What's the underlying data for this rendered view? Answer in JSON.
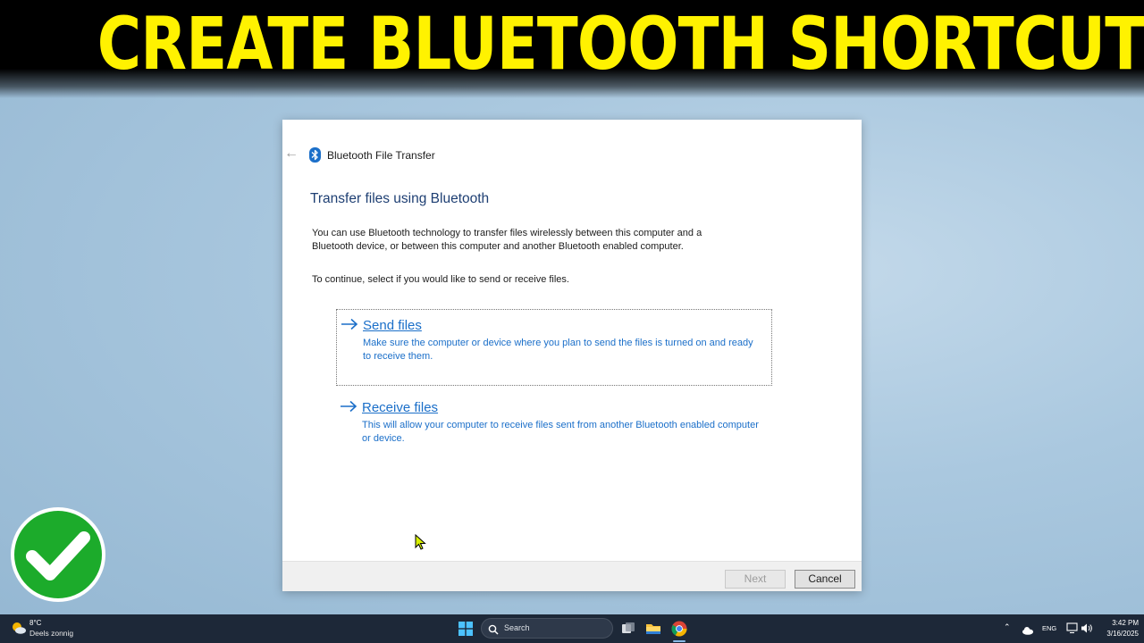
{
  "banner": {
    "title": "CREATE BLUETOOTH SHORTCUT"
  },
  "dialog": {
    "title": "Bluetooth File Transfer",
    "heading": "Transfer files using Bluetooth",
    "description": "You can use Bluetooth technology to transfer files wirelessly between this computer and a Bluetooth device, or between this computer and another Bluetooth enabled computer.",
    "instruction": "To continue, select if you would like to send or receive files.",
    "options": [
      {
        "title": "Send files",
        "description": "Make sure the computer or device where you plan to send the files is turned on and ready to receive them."
      },
      {
        "title": "Receive files",
        "description": "This will allow your computer to receive files sent from another Bluetooth enabled computer or device."
      }
    ],
    "buttons": {
      "next": "Next",
      "cancel": "Cancel"
    }
  },
  "taskbar": {
    "weather": {
      "temp": "8°C",
      "desc": "Deels zonnig",
      "icon": "partly-sunny-icon"
    },
    "search_label": "Search",
    "apps": [
      "task-view-icon",
      "file-explorer-icon",
      "chrome-icon"
    ],
    "tray": {
      "language": "ENG",
      "time": "3:42 PM",
      "date": "3/16/2025"
    }
  },
  "colors": {
    "banner_text": "#fff200",
    "link_blue": "#1b6fc9",
    "heading_blue": "#1e3f73",
    "check_green": "#1cab2b"
  }
}
